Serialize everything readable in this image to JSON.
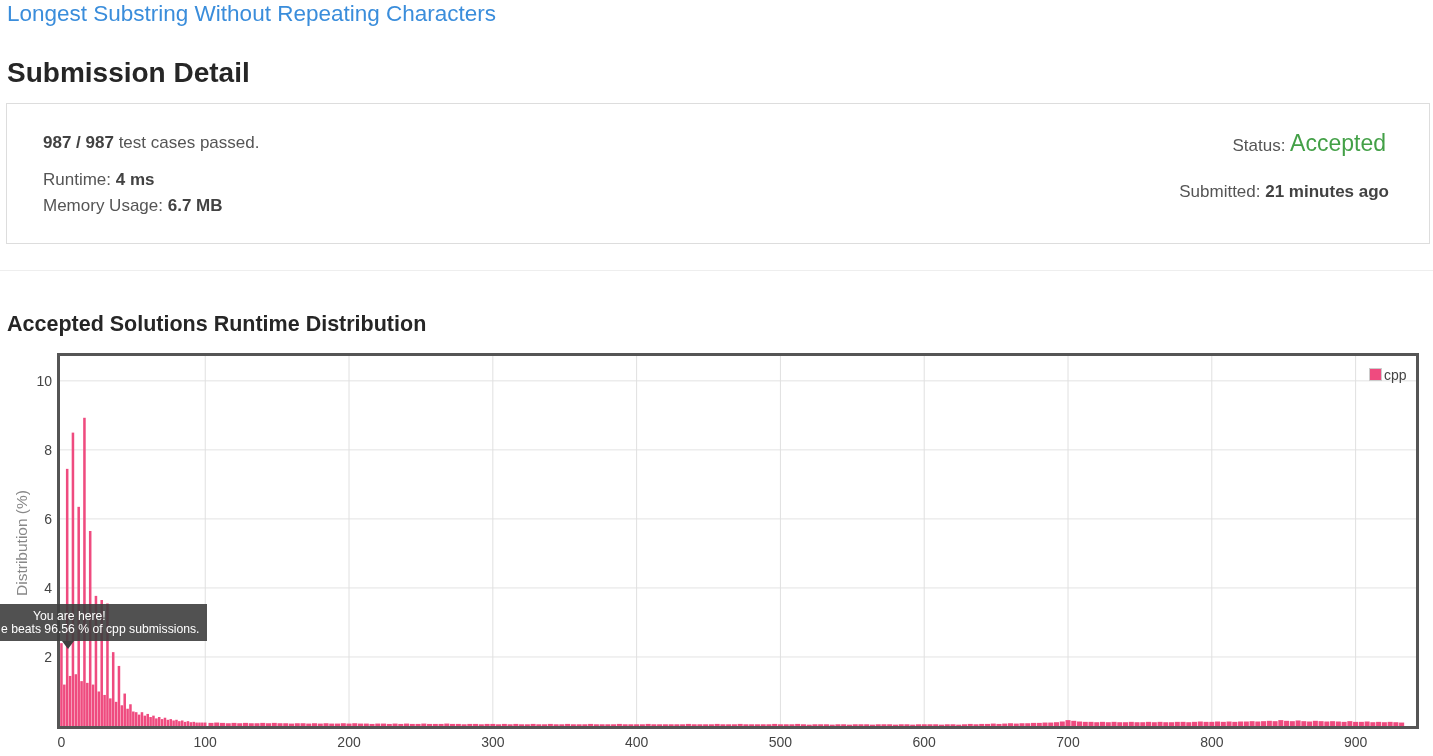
{
  "problem_link": "Longest Substring Without Repeating Characters",
  "title": "Submission Detail",
  "submission": {
    "test_cases": "**987 / 987** test cases passed.",
    "runtime": "Runtime: **4 ms**",
    "memory": "Memory Usage: **6.7 MB**",
    "status_label": "Status:",
    "status": "Accepted",
    "submitted": "Submitted: **21 minutes ago**"
  },
  "runtime_distribution": {
    "title": "Accepted Solutions Runtime Distribution",
    "chart_data": {
      "type": "bar",
      "ylabel": "Distribution (%)",
      "x": [
        0,
        2,
        4,
        6,
        8,
        10,
        12,
        14,
        16,
        18,
        20,
        22,
        24,
        26,
        28,
        30,
        32,
        34,
        36,
        38,
        40,
        42,
        44,
        46,
        48,
        50,
        52,
        54,
        56,
        58,
        60,
        62,
        64,
        66,
        68,
        70,
        72,
        74,
        76,
        78,
        80,
        82,
        84,
        86,
        88,
        90,
        92,
        94,
        96,
        98,
        100,
        104,
        108,
        112,
        116,
        120,
        124,
        128,
        132,
        136,
        140,
        144,
        148,
        152,
        156,
        160,
        164,
        168,
        172,
        176,
        180,
        184,
        188,
        192,
        196,
        200,
        204,
        208,
        212,
        216,
        220,
        224,
        228,
        232,
        236,
        240,
        244,
        248,
        252,
        256,
        260,
        264,
        268,
        272,
        276,
        280,
        284,
        288,
        292,
        296,
        300,
        304,
        308,
        312,
        316,
        320,
        324,
        328,
        332,
        336,
        340,
        344,
        348,
        352,
        356,
        360,
        364,
        368,
        372,
        376,
        380,
        384,
        388,
        392,
        396,
        400,
        404,
        408,
        412,
        416,
        420,
        424,
        428,
        432,
        436,
        440,
        444,
        448,
        452,
        456,
        460,
        464,
        468,
        472,
        476,
        480,
        484,
        488,
        492,
        496,
        500,
        504,
        508,
        512,
        516,
        520,
        524,
        528,
        532,
        536,
        540,
        544,
        548,
        552,
        556,
        560,
        564,
        568,
        572,
        576,
        580,
        584,
        588,
        592,
        596,
        600,
        604,
        608,
        612,
        616,
        620,
        624,
        628,
        632,
        636,
        640,
        644,
        648,
        652,
        656,
        660,
        664,
        668,
        672,
        676,
        680,
        684,
        688,
        692,
        696,
        700,
        704,
        708,
        712,
        716,
        720,
        724,
        728,
        732,
        736,
        740,
        744,
        748,
        752,
        756,
        760,
        764,
        768,
        772,
        776,
        780,
        784,
        788,
        792,
        796,
        800,
        804,
        808,
        812,
        816,
        820,
        824,
        828,
        832,
        836,
        840,
        844,
        848,
        852,
        856,
        860,
        864,
        868,
        872,
        876,
        880,
        884,
        888,
        892,
        896,
        900,
        904,
        908,
        912,
        916,
        920,
        924,
        928,
        932
      ],
      "series": [
        {
          "name": "cpp",
          "color": "#ef4b7f",
          "values": [
            2.4,
            1.2,
            7.45,
            1.45,
            8.5,
            1.5,
            6.35,
            1.3,
            8.93,
            1.25,
            5.65,
            1.2,
            3.77,
            1.0,
            3.65,
            0.9,
            3.55,
            0.8,
            2.14,
            0.7,
            1.74,
            0.6,
            0.94,
            0.5,
            0.63,
            0.42,
            0.4,
            0.33,
            0.4,
            0.3,
            0.35,
            0.26,
            0.3,
            0.22,
            0.26,
            0.2,
            0.24,
            0.18,
            0.2,
            0.16,
            0.18,
            0.14,
            0.16,
            0.12,
            0.14,
            0.11,
            0.12,
            0.1,
            0.1,
            0.1,
            0.1,
            0.09,
            0.1,
            0.09,
            0.08,
            0.09,
            0.08,
            0.09,
            0.08,
            0.08,
            0.09,
            0.08,
            0.09,
            0.08,
            0.08,
            0.07,
            0.08,
            0.08,
            0.07,
            0.08,
            0.07,
            0.08,
            0.07,
            0.07,
            0.08,
            0.07,
            0.08,
            0.07,
            0.07,
            0.06,
            0.07,
            0.07,
            0.06,
            0.07,
            0.06,
            0.07,
            0.06,
            0.06,
            0.07,
            0.06,
            0.06,
            0.06,
            0.07,
            0.06,
            0.06,
            0.05,
            0.06,
            0.06,
            0.05,
            0.06,
            0.06,
            0.05,
            0.06,
            0.05,
            0.06,
            0.05,
            0.05,
            0.06,
            0.05,
            0.05,
            0.06,
            0.05,
            0.05,
            0.06,
            0.05,
            0.05,
            0.05,
            0.06,
            0.05,
            0.05,
            0.05,
            0.05,
            0.06,
            0.05,
            0.05,
            0.05,
            0.05,
            0.06,
            0.05,
            0.05,
            0.05,
            0.05,
            0.05,
            0.05,
            0.06,
            0.05,
            0.05,
            0.05,
            0.05,
            0.06,
            0.05,
            0.05,
            0.05,
            0.06,
            0.05,
            0.05,
            0.05,
            0.05,
            0.05,
            0.06,
            0.05,
            0.05,
            0.05,
            0.06,
            0.05,
            0.04,
            0.05,
            0.05,
            0.05,
            0.04,
            0.05,
            0.05,
            0.04,
            0.05,
            0.05,
            0.05,
            0.04,
            0.05,
            0.05,
            0.05,
            0.04,
            0.05,
            0.05,
            0.04,
            0.05,
            0.05,
            0.05,
            0.05,
            0.04,
            0.05,
            0.05,
            0.04,
            0.05,
            0.06,
            0.05,
            0.06,
            0.06,
            0.07,
            0.06,
            0.07,
            0.08,
            0.07,
            0.08,
            0.08,
            0.09,
            0.09,
            0.1,
            0.1,
            0.11,
            0.13,
            0.17,
            0.15,
            0.13,
            0.12,
            0.12,
            0.11,
            0.12,
            0.11,
            0.12,
            0.11,
            0.11,
            0.12,
            0.11,
            0.11,
            0.12,
            0.11,
            0.12,
            0.11,
            0.11,
            0.12,
            0.12,
            0.11,
            0.12,
            0.13,
            0.12,
            0.12,
            0.13,
            0.12,
            0.13,
            0.12,
            0.13,
            0.13,
            0.14,
            0.13,
            0.14,
            0.15,
            0.14,
            0.17,
            0.15,
            0.14,
            0.16,
            0.14,
            0.13,
            0.15,
            0.14,
            0.13,
            0.14,
            0.13,
            0.12,
            0.14,
            0.12,
            0.12,
            0.13,
            0.11,
            0.12,
            0.11,
            0.12,
            0.11,
            0.1
          ]
        }
      ],
      "xlim": [
        -1,
        942
      ],
      "ylim": [
        0,
        10.72
      ],
      "xticks": [
        0,
        100,
        200,
        300,
        400,
        500,
        600,
        700,
        800,
        900
      ],
      "yticks": [
        2,
        4,
        6,
        8,
        10
      ],
      "grid": true
    },
    "tooltip": {
      "lines": [
        "You are here!",
        "e beats 96.56 % of cpp submissions."
      ]
    }
  }
}
